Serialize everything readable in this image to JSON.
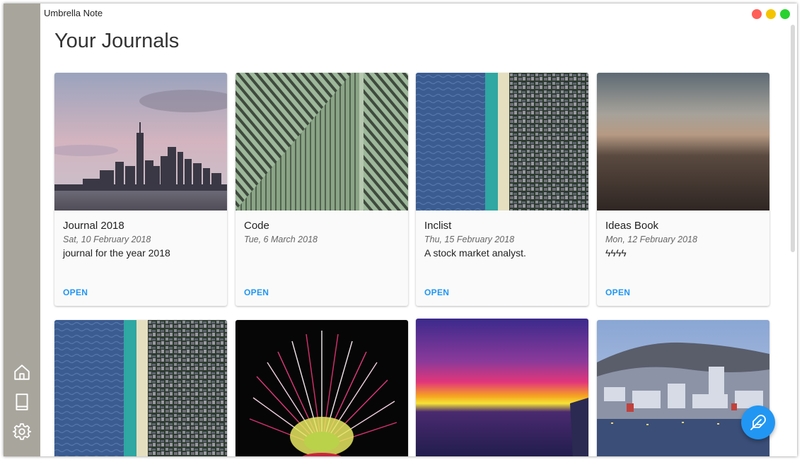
{
  "app": {
    "title": "Umbrella Note"
  },
  "page": {
    "title": "Your Journals"
  },
  "sidebar": {
    "items": [
      {
        "name": "home",
        "icon": "home-icon"
      },
      {
        "name": "journals",
        "icon": "book-icon"
      },
      {
        "name": "settings",
        "icon": "gear-icon"
      }
    ]
  },
  "journals": [
    {
      "title": "Journal 2018",
      "date": "Sat, 10 February 2018",
      "description": "journal for the year 2018",
      "action": "OPEN",
      "image": "city skyline"
    },
    {
      "title": "Code",
      "date": "Tue, 6 March 2018",
      "description": "",
      "action": "OPEN",
      "image": "green striped facade"
    },
    {
      "title": "Inclist",
      "date": "Thu, 15 February 2018",
      "description": "A stock market analyst.",
      "action": "OPEN",
      "image": "aerial coastline"
    },
    {
      "title": "Ideas Book",
      "date": "Mon, 12 February 2018",
      "description": "ϟϟϟϟ",
      "action": "OPEN",
      "image": "blurred landscape"
    },
    {
      "image": "aerial coastline"
    },
    {
      "image": "pink flower"
    },
    {
      "image": "sunset over sea"
    },
    {
      "image": "harbor town"
    }
  ],
  "fab": {
    "icon": "feather-icon"
  },
  "colors": {
    "accent": "#2196f3",
    "sidebar": "#a8a59c"
  }
}
